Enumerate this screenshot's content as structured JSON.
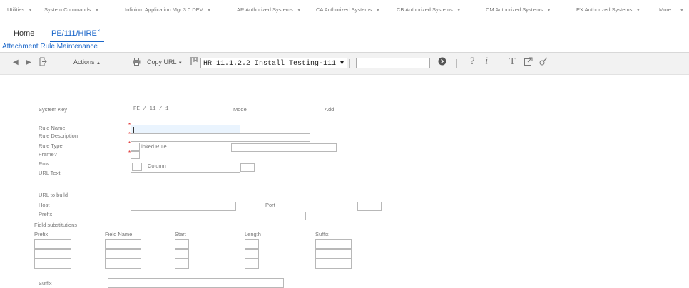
{
  "menu": [
    {
      "label": "Utilities",
      "caret": "▼"
    },
    {
      "label": "System Commands",
      "caret": "▼"
    },
    {
      "label": "Infinium Application Mgr 3.0 DEV",
      "caret": "▼"
    },
    {
      "label": "AR Authorized Systems",
      "caret": "▼"
    },
    {
      "label": "CA Authorized Systems",
      "caret": "▼"
    },
    {
      "label": "CB Authorized Systems",
      "caret": "▼"
    },
    {
      "label": "CM Authorized Systems",
      "caret": "▼"
    },
    {
      "label": "EX Authorized Systems",
      "caret": "▼"
    },
    {
      "label": "More...",
      "caret": "▼"
    }
  ],
  "tabs": {
    "home": "Home",
    "active": "PE/111/HIRE",
    "active_close": "×"
  },
  "page_title": "Attachment Rule Maintenance",
  "toolbar": {
    "actions_label": "Actions",
    "actions_caret": "▲",
    "copy_url_label": "Copy URL",
    "copy_url_caret": "▼",
    "env_select": "HR 11.1.2.2 Install Testing-111",
    "env_caret": "▾",
    "search_value": ""
  },
  "form": {
    "system_key_label": "System Key",
    "system_key_value": "PE  /  11  /  1",
    "mode_label": "Mode",
    "mode_value": "Add",
    "rule_name_label": "Rule Name",
    "rule_name_value": "",
    "rule_desc_label": "Rule Description",
    "rule_type_label": "Rule Type",
    "rule_type_value": "Linked Rule",
    "frame_label": "Frame?",
    "row_label": "Row",
    "column_label": "Column",
    "url_text_label": "URL Text",
    "url_build_label": "URL to build",
    "host_label": "Host",
    "port_label": "Port",
    "prefix_label": "Prefix",
    "field_subs_label": "Field substitutions",
    "col_prefix": "Prefix",
    "col_field_name": "Field Name",
    "col_start": "Start",
    "col_length": "Length",
    "col_suffix": "Suffix",
    "suffix_label": "Suffix"
  }
}
